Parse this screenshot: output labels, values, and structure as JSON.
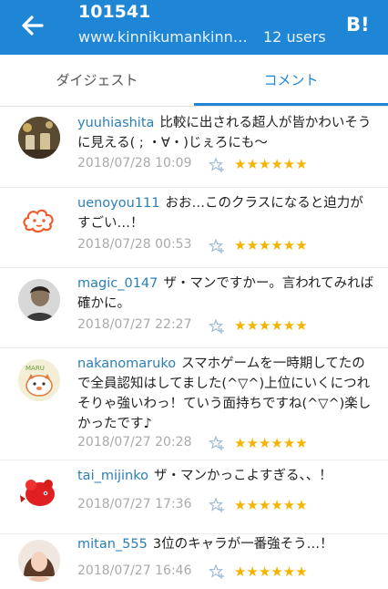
{
  "appbar": {
    "title": "101541",
    "url": "www.kinnikumankinnikumankinnikuman",
    "users": "12 users",
    "back_icon": "arrow-left-icon",
    "hatena_icon": "hatena-bookmark-icon",
    "hatena_label": "B!",
    "bg_color": "#1f86d6"
  },
  "tabs": [
    {
      "label": "ダイジェスト",
      "active": false
    },
    {
      "label": "コメント",
      "active": true
    }
  ],
  "comments": [
    {
      "user": "yuuhiashita",
      "text": "比較に出される超人が皆かわいそうに見える( ; ・∀・)じぇろにも〜",
      "date": "2018/07/28 10:09",
      "stars": "★★★★★★"
    },
    {
      "user": "uenoyou111",
      "text": "おお…このクラスになると迫力がすごい…！",
      "date": "2018/07/28 00:53",
      "stars": "★★★★★★"
    },
    {
      "user": "magic_0147",
      "text": "ザ・マンですかー。言われてみれば確かに。",
      "date": "2018/07/27 22:27",
      "stars": "★★★★★★"
    },
    {
      "user": "nakanomaruko",
      "text": "スマホゲームを一時期してたので全員認知はしてました(^▽^)上位にいくにつれそりゃ強いわっ！ていう面持ちですね(^▽^)楽しかったです♪",
      "date": "2018/07/27 20:28",
      "stars": "★★★★★★"
    },
    {
      "user": "tai_mijinko",
      "text": "ザ・マンかっこよすぎる、、！",
      "date": "2018/07/27 17:36",
      "stars": "★★★★★★"
    },
    {
      "user": "mitan_555",
      "text": "3位のキャラが一番強そう…！",
      "date": "2018/07/27 16:46",
      "stars": "★★★★★★"
    }
  ],
  "avatar_labels": {
    "maru": "MARU"
  },
  "star_color": "#f5b400",
  "add_star_icon": "add-star-icon"
}
